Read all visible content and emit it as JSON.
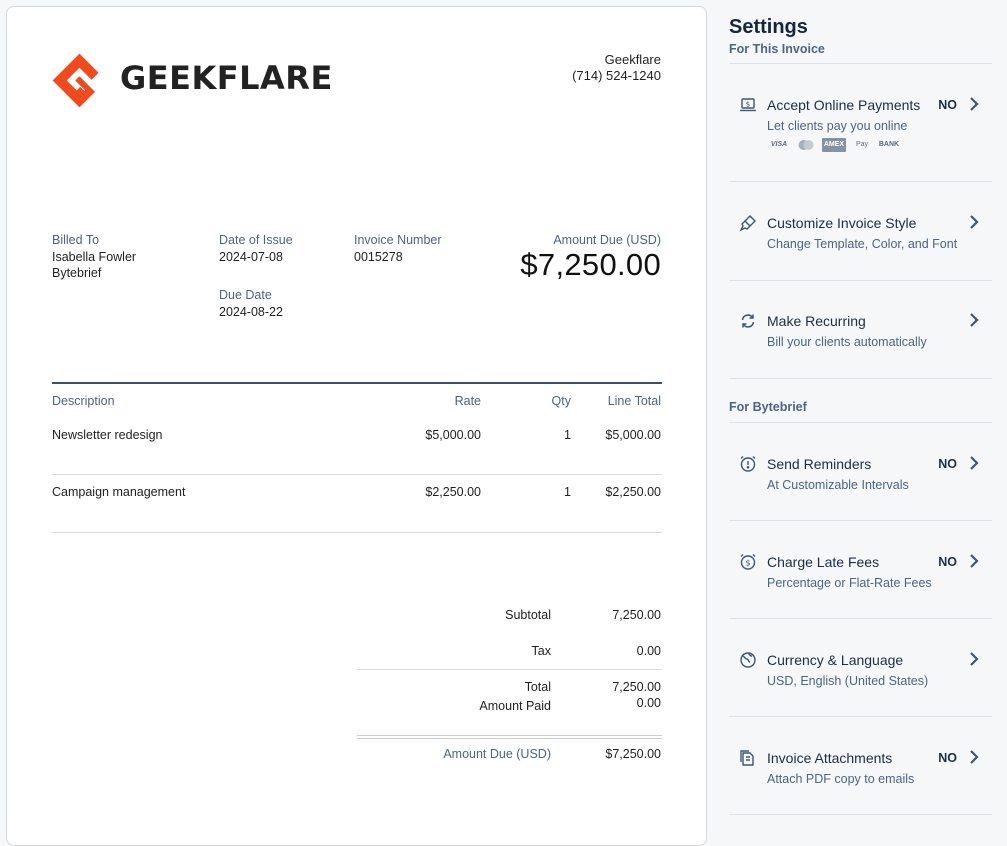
{
  "invoice": {
    "logo_text": "GEEKFLARE",
    "company_name": "Geekflare",
    "company_phone": "(714) 524-1240",
    "billed_to_label": "Billed To",
    "client_name": "Isabella Fowler",
    "client_company": "Bytebrief",
    "date_of_issue_label": "Date of Issue",
    "date_of_issue": "2024-07-08",
    "due_date_label": "Due Date",
    "due_date": "2024-08-22",
    "invoice_number_label": "Invoice Number",
    "invoice_number": "0015278",
    "amount_due_label": "Amount Due (USD)",
    "amount_due": "$7,250.00",
    "columns": {
      "description": "Description",
      "rate": "Rate",
      "qty": "Qty",
      "line_total": "Line Total"
    },
    "line_items": [
      {
        "description": "Newsletter redesign",
        "rate": "$5,000.00",
        "qty": "1",
        "total": "$5,000.00"
      },
      {
        "description": "Campaign management",
        "rate": "$2,250.00",
        "qty": "1",
        "total": "$2,250.00"
      }
    ],
    "totals": {
      "subtotal_label": "Subtotal",
      "subtotal": "7,250.00",
      "tax_label": "Tax",
      "tax": "0.00",
      "total_label": "Total",
      "total": "7,250.00",
      "amount_paid_label": "Amount Paid",
      "amount_paid": "0.00",
      "amount_due_label": "Amount Due (USD)",
      "amount_due": "$7,250.00"
    }
  },
  "settings": {
    "title": "Settings",
    "section_invoice": "For This Invoice",
    "section_client": "For Bytebrief",
    "items": [
      {
        "label": "Accept Online Payments",
        "sub": "Let clients pay you online",
        "status": "NO",
        "icon": "laptop-dollar-icon"
      },
      {
        "label": "Customize Invoice Style",
        "sub": "Change Template, Color, and Font",
        "status": "",
        "icon": "paint-brush-icon"
      },
      {
        "label": "Make Recurring",
        "sub": "Bill your clients automatically",
        "status": "",
        "icon": "refresh-icon"
      },
      {
        "label": "Send Reminders",
        "sub": "At Customizable Intervals",
        "status": "NO",
        "icon": "alarm-clock-icon"
      },
      {
        "label": "Charge Late Fees",
        "sub": "Percentage or Flat-Rate Fees",
        "status": "NO",
        "icon": "dollar-clock-icon"
      },
      {
        "label": "Currency & Language",
        "sub": "USD, English (United States)",
        "status": "",
        "icon": "globe-currency-icon"
      },
      {
        "label": "Invoice Attachments",
        "sub": "Attach PDF copy to emails",
        "status": "NO",
        "icon": "attachment-document-icon"
      }
    ],
    "payment_cards": [
      "VISA",
      "AMEX",
      "Pay",
      "BANK"
    ],
    "colors": {
      "accent": "#f04a1f",
      "heading": "#12263f",
      "muted": "#4b6582"
    }
  }
}
